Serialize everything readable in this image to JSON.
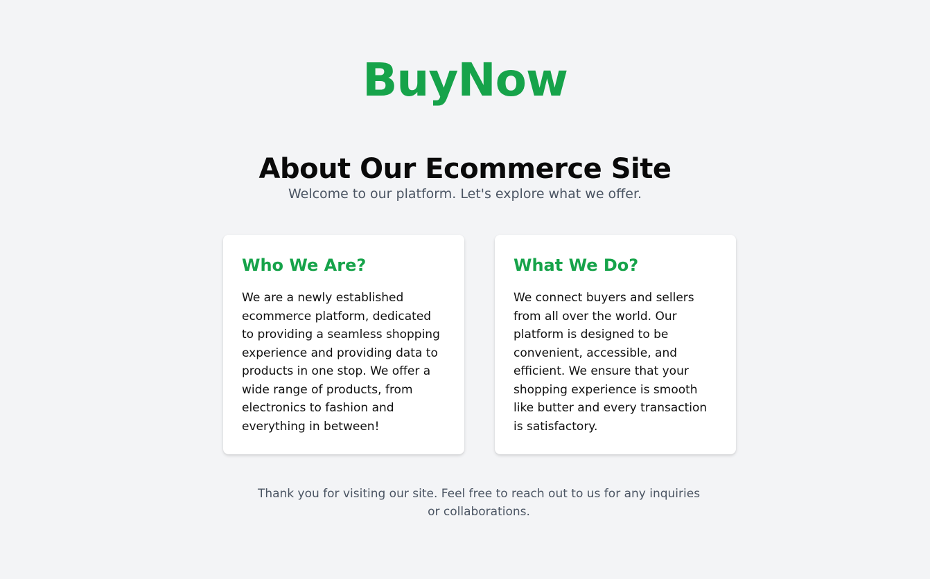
{
  "header": {
    "brand": "BuyNow"
  },
  "about": {
    "title": "About Our Ecommerce Site",
    "subtitle": "Welcome to our platform. Let's explore what we offer."
  },
  "cards": [
    {
      "title": "Who We Are?",
      "body": "We are a newly established ecommerce platform, dedicated to providing a seamless shopping experience and providing data to products in one stop. We offer a wide range of products, from electronics to fashion and everything in between!"
    },
    {
      "title": "What We Do?",
      "body": "We connect buyers and sellers from all over the world. Our platform is designed to be convenient, accessible, and efficient. We ensure that your shopping experience is smooth like butter and every transaction is satisfactory."
    }
  ],
  "footer": {
    "text": "Thank you for visiting our site. Feel free to reach out to us for any inquiries or collaborations."
  },
  "colors": {
    "brand_green": "#16a34a",
    "background": "#f3f4f6",
    "card_background": "#ffffff",
    "muted_text": "#4b5563"
  }
}
